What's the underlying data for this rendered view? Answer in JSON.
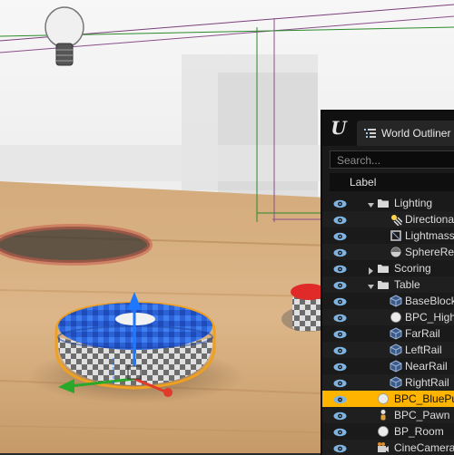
{
  "outliner": {
    "tab_label": "World Outliner",
    "search_placeholder": "Search...",
    "column_label": "Label",
    "rows": [
      {
        "label": "Lighting",
        "icon": "folder-icon",
        "expanded": true
      },
      {
        "label": "Directiona",
        "icon": "directional-light-icon"
      },
      {
        "label": "Lightmass",
        "icon": "lightmass-volume-icon"
      },
      {
        "label": "SphereRef",
        "icon": "sphere-reflection-icon"
      },
      {
        "label": "Scoring",
        "icon": "folder-icon",
        "expanded": false
      },
      {
        "label": "Table",
        "icon": "folder-icon",
        "expanded": true
      },
      {
        "label": "BaseBlock",
        "icon": "static-mesh-icon"
      },
      {
        "label": "BPC_High",
        "icon": "blueprint-sphere-icon"
      },
      {
        "label": "FarRail",
        "icon": "static-mesh-icon"
      },
      {
        "label": "LeftRail",
        "icon": "static-mesh-icon"
      },
      {
        "label": "NearRail",
        "icon": "static-mesh-icon"
      },
      {
        "label": "RightRail",
        "icon": "static-mesh-icon"
      },
      {
        "label": "BPC_BluePu",
        "icon": "blueprint-sphere-icon",
        "selected": true
      },
      {
        "label": "BPC_Pawn",
        "icon": "pawn-icon"
      },
      {
        "label": "BP_Room",
        "icon": "blueprint-sphere-icon"
      },
      {
        "label": "CineCamera",
        "icon": "cine-camera-icon"
      }
    ]
  },
  "colors": {
    "selection": "#ffb400",
    "panel_bg": "#1a1a1a",
    "eye": "#7fb4e0",
    "folder": "#d8d8d8"
  }
}
